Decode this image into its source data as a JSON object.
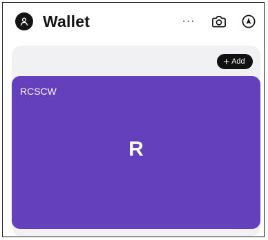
{
  "header": {
    "title": "Wallet",
    "more_label": "···",
    "icons": [
      "user-avatar-icon",
      "camera-icon",
      "navigation-icon"
    ]
  },
  "wallet": {
    "add_label": "Add",
    "card": {
      "name": "RCSCW",
      "initial": "R",
      "color": "#6540bd"
    }
  }
}
